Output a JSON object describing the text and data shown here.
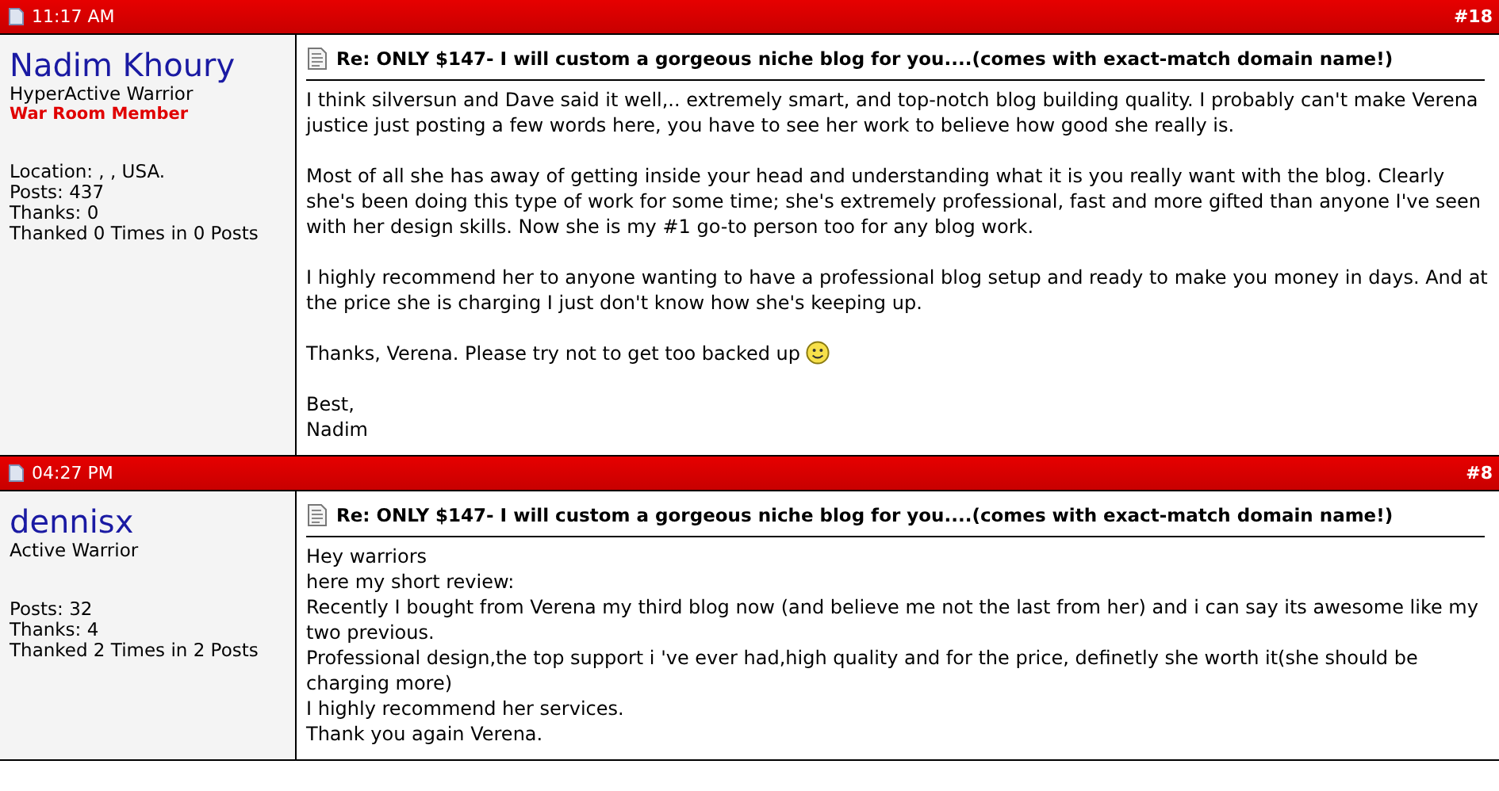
{
  "posts": [
    {
      "time": "11:17 AM",
      "number": "#18",
      "user": {
        "name": "Nadim Khoury",
        "title": "HyperActive Warrior",
        "badge": "War Room Member",
        "stats": [
          "Location: , , USA.",
          "Posts: 437",
          "Thanks: 0",
          "Thanked 0 Times in 0 Posts"
        ]
      },
      "subject": "Re: ONLY $147- I will custom a gorgeous niche blog for you....(comes with exact-match domain name!)",
      "paragraphs": [
        {
          "lines": [
            "I think silversun and Dave said it well,.. extremely smart, and top-notch blog building quality. I probably can't make Verena justice just posting a few words here, you have to see her work to believe how good she really is."
          ]
        },
        {
          "lines": [
            "Most of all she has away of getting inside your head and understanding what it is you really want with the blog. Clearly she's been doing this type of work for some time; she's extremely professional, fast and more gifted than anyone I've seen with her design skills. Now she is my #1 go-to person too for any blog work."
          ]
        },
        {
          "lines": [
            "I highly recommend her to anyone wanting to have a professional blog setup and ready to make you money in days. And at the price she is charging I just don't know how she's keeping up."
          ]
        },
        {
          "lines": [
            "Thanks, Verena. Please try not to get too backed up"
          ],
          "smiley": true
        },
        {
          "lines": [
            "Best,",
            "Nadim"
          ]
        }
      ]
    },
    {
      "time": "04:27 PM",
      "number": "#8",
      "user": {
        "name": "dennisx",
        "title": "Active Warrior",
        "stats": [
          "Posts: 32",
          "Thanks: 4",
          "Thanked 2 Times in 2 Posts"
        ]
      },
      "subject": "Re: ONLY $147- I will custom a gorgeous niche blog for you....(comes with exact-match domain name!)",
      "paragraphs": [
        {
          "lines": [
            "Hey warriors",
            "here my short review:",
            "Recently I bought from Verena my third blog now (and believe me not the last from her) and i can say its awesome like my two previous.",
            "Professional design,the top support i 've ever had,high quality and for the price, definetly she worth it(she should be charging more)",
            "I highly recommend her services.",
            "Thank you again Verena."
          ]
        }
      ]
    }
  ]
}
